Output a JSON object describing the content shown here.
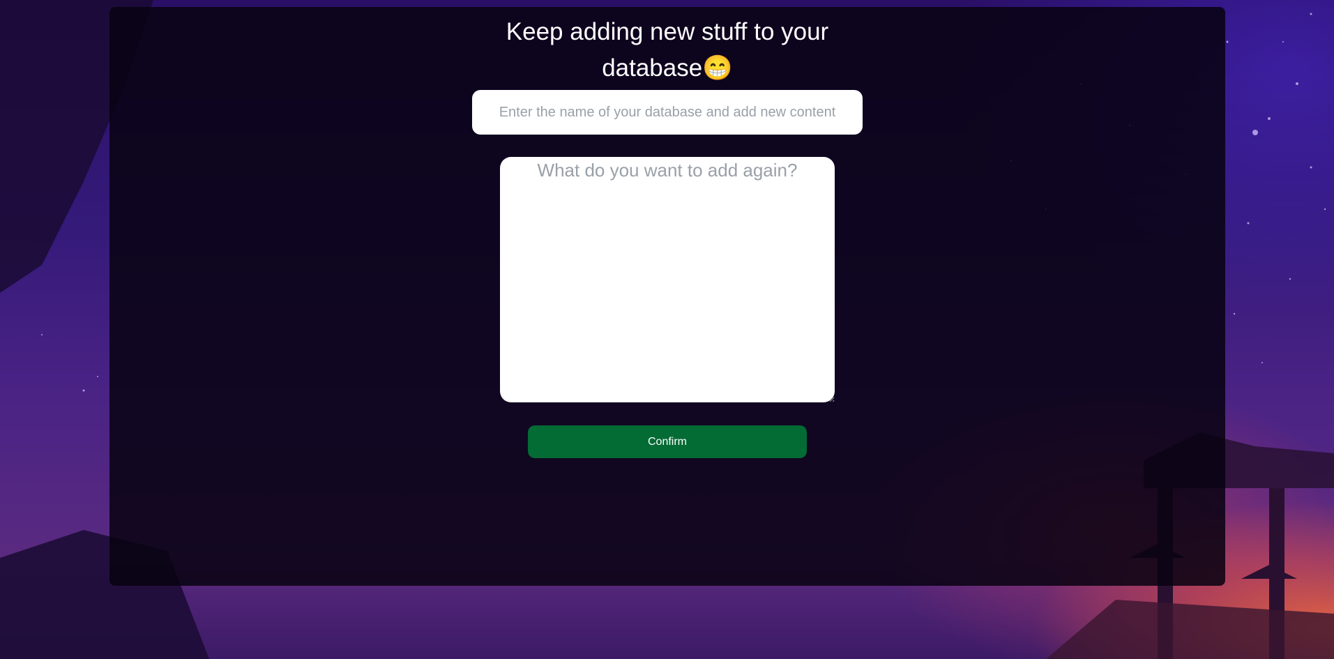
{
  "heading": {
    "line1": "Keep adding new stuff to your",
    "line2": "database",
    "emoji": "😁"
  },
  "form": {
    "database_input": {
      "value": "",
      "placeholder": "Enter the name of your database and add new content"
    },
    "content_textarea": {
      "value": "",
      "placeholder": "What do you want to add again?"
    },
    "confirm_label": "Confirm"
  },
  "colors": {
    "panel_bg": "#08021286",
    "confirm_button": "#036b34",
    "background_top": "#2a0f66",
    "sunset_glow": "#ff6e3c"
  }
}
